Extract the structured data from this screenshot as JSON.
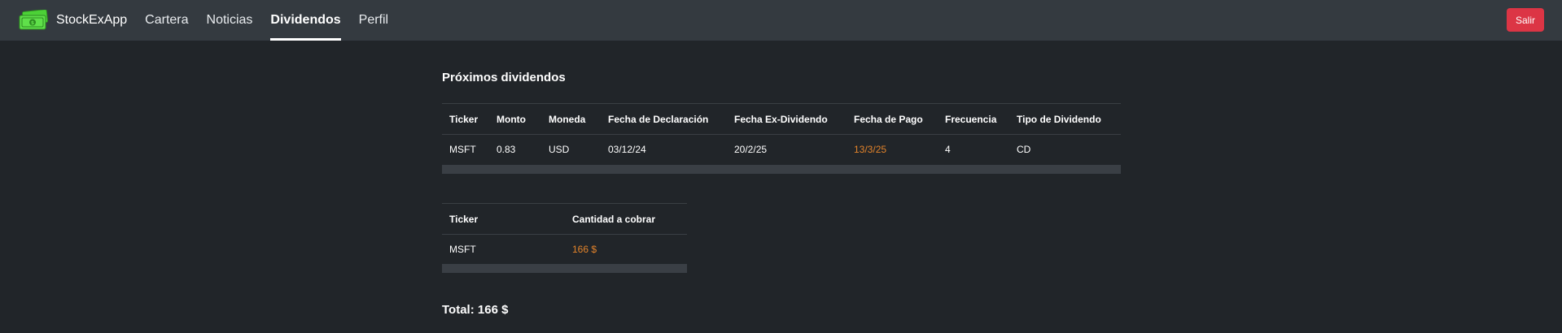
{
  "navbar": {
    "brand": "StockExApp",
    "links": [
      {
        "label": "Cartera",
        "active": false
      },
      {
        "label": "Noticias",
        "active": false
      },
      {
        "label": "Dividendos",
        "active": true
      },
      {
        "label": "Perfil",
        "active": false
      }
    ],
    "logout_label": "Salir"
  },
  "colors": {
    "navbar_bg": "#343a40",
    "page_bg": "#212529",
    "accent_orange": "#e2832a",
    "logout_red": "#dc3545",
    "brand_icon": "#4cd137"
  },
  "icons": {
    "brand": "money-bills-icon"
  },
  "upcoming": {
    "title": "Próximos dividendos",
    "columns": [
      "Ticker",
      "Monto",
      "Moneda",
      "Fecha de Declaración",
      "Fecha Ex-Dividendo",
      "Fecha de Pago",
      "Frecuencia",
      "Tipo de Dividendo"
    ],
    "rows": [
      [
        "MSFT",
        "0.83",
        "USD",
        "03/12/24",
        "20/2/25",
        "13/3/25",
        "4",
        "CD"
      ]
    ]
  },
  "collect": {
    "columns": [
      "Ticker",
      "Cantidad a cobrar"
    ],
    "rows": [
      [
        "MSFT",
        "166 $"
      ]
    ]
  },
  "total": "Total: 166 $"
}
